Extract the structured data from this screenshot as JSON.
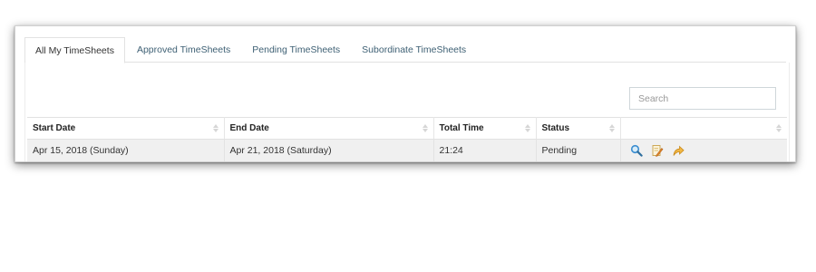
{
  "tabs": [
    {
      "label": "All My TimeSheets",
      "active": true
    },
    {
      "label": "Approved TimeSheets",
      "active": false
    },
    {
      "label": "Pending TimeSheets",
      "active": false
    },
    {
      "label": "Subordinate TimeSheets",
      "active": false
    }
  ],
  "search": {
    "placeholder": "Search",
    "value": ""
  },
  "table": {
    "columns": [
      "Start Date",
      "End Date",
      "Total Time",
      "Status",
      ""
    ],
    "rows": [
      {
        "start_date": "Apr 15, 2018 (Sunday)",
        "end_date": "Apr 21, 2018 (Saturday)",
        "total_time": "21:24",
        "status": "Pending",
        "actions": [
          "view-icon",
          "edit-icon",
          "submit-icon"
        ]
      }
    ]
  },
  "colors": {
    "tab_text": "#3e6074",
    "row_bg": "#f0f0f0",
    "accent_blue": "#3b8dd0",
    "accent_orange": "#e39a2b"
  }
}
